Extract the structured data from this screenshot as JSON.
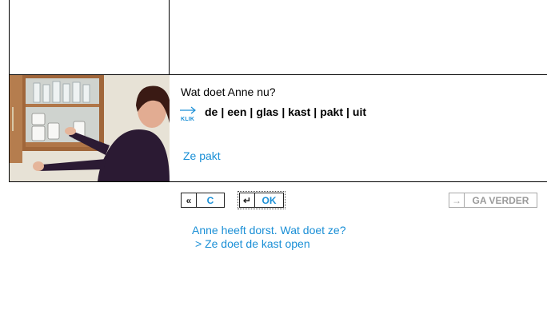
{
  "question": "Wat doet Anne nu?",
  "klik_label": "KLIK",
  "words": [
    "de",
    "een",
    "glas",
    "kast",
    "pakt",
    "uit"
  ],
  "separator": "|",
  "answer_text": "Ze pakt",
  "buttons": {
    "clear_icon": "«",
    "clear_label": "C",
    "ok_icon": "↵",
    "ok_label": "OK",
    "next_icon": "→",
    "next_label": "GA VERDER"
  },
  "feedback": {
    "line1": "Anne heeft dorst. Wat doet ze?",
    "line2": "> Ze doet de kast open"
  },
  "colors": {
    "accent": "#1a8fd6",
    "disabled": "#a8a8a8"
  }
}
